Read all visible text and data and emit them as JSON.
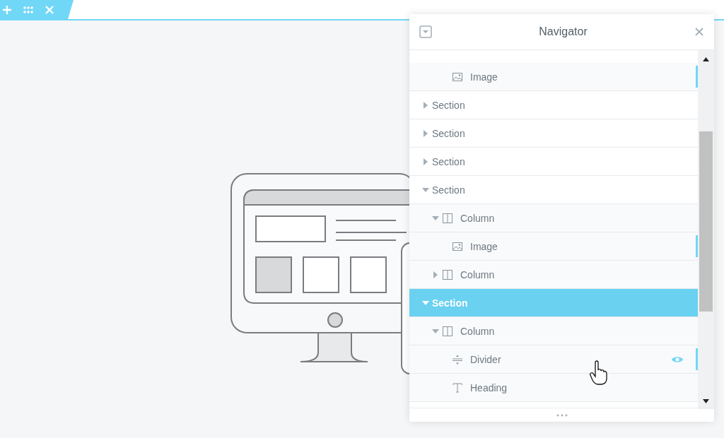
{
  "toolbar": {
    "buttons": [
      {
        "kind": "add"
      },
      {
        "kind": "drag"
      },
      {
        "kind": "close"
      }
    ]
  },
  "navigator": {
    "title": "Navigator",
    "tree": [
      {
        "kind": "offscreen",
        "children": [
          {
            "kind": "offscreen",
            "children": [
              {
                "kind": "image",
                "label": "Image",
                "marked": true,
                "selected": false,
                "hovered": false
              }
            ]
          }
        ]
      },
      {
        "kind": "section",
        "label": "Section",
        "expanded": false,
        "selected": false,
        "marked": false,
        "hovered": false
      },
      {
        "kind": "section",
        "label": "Section",
        "expanded": false,
        "selected": false,
        "marked": false,
        "hovered": false
      },
      {
        "kind": "section",
        "label": "Section",
        "expanded": false,
        "selected": false,
        "marked": false,
        "hovered": false
      },
      {
        "kind": "section",
        "label": "Section",
        "expanded": true,
        "selected": false,
        "marked": false,
        "hovered": false,
        "children": [
          {
            "kind": "column",
            "label": "Column",
            "expanded": true,
            "selected": false,
            "marked": false,
            "hovered": false,
            "children": [
              {
                "kind": "image",
                "label": "Image",
                "marked": true,
                "selected": false,
                "hovered": false
              }
            ]
          },
          {
            "kind": "column",
            "label": "Column",
            "expanded": false,
            "selected": false,
            "marked": false,
            "hovered": false
          }
        ]
      },
      {
        "kind": "section",
        "label": "Section",
        "expanded": true,
        "selected": true,
        "marked": false,
        "hovered": false,
        "children": [
          {
            "kind": "column",
            "label": "Column",
            "expanded": true,
            "selected": false,
            "marked": false,
            "hovered": false,
            "children": [
              {
                "kind": "divider",
                "label": "Divider",
                "marked": true,
                "selected": false,
                "hovered": true
              },
              {
                "kind": "heading",
                "label": "Heading",
                "marked": false,
                "selected": false,
                "hovered": false
              }
            ]
          }
        ]
      }
    ]
  }
}
